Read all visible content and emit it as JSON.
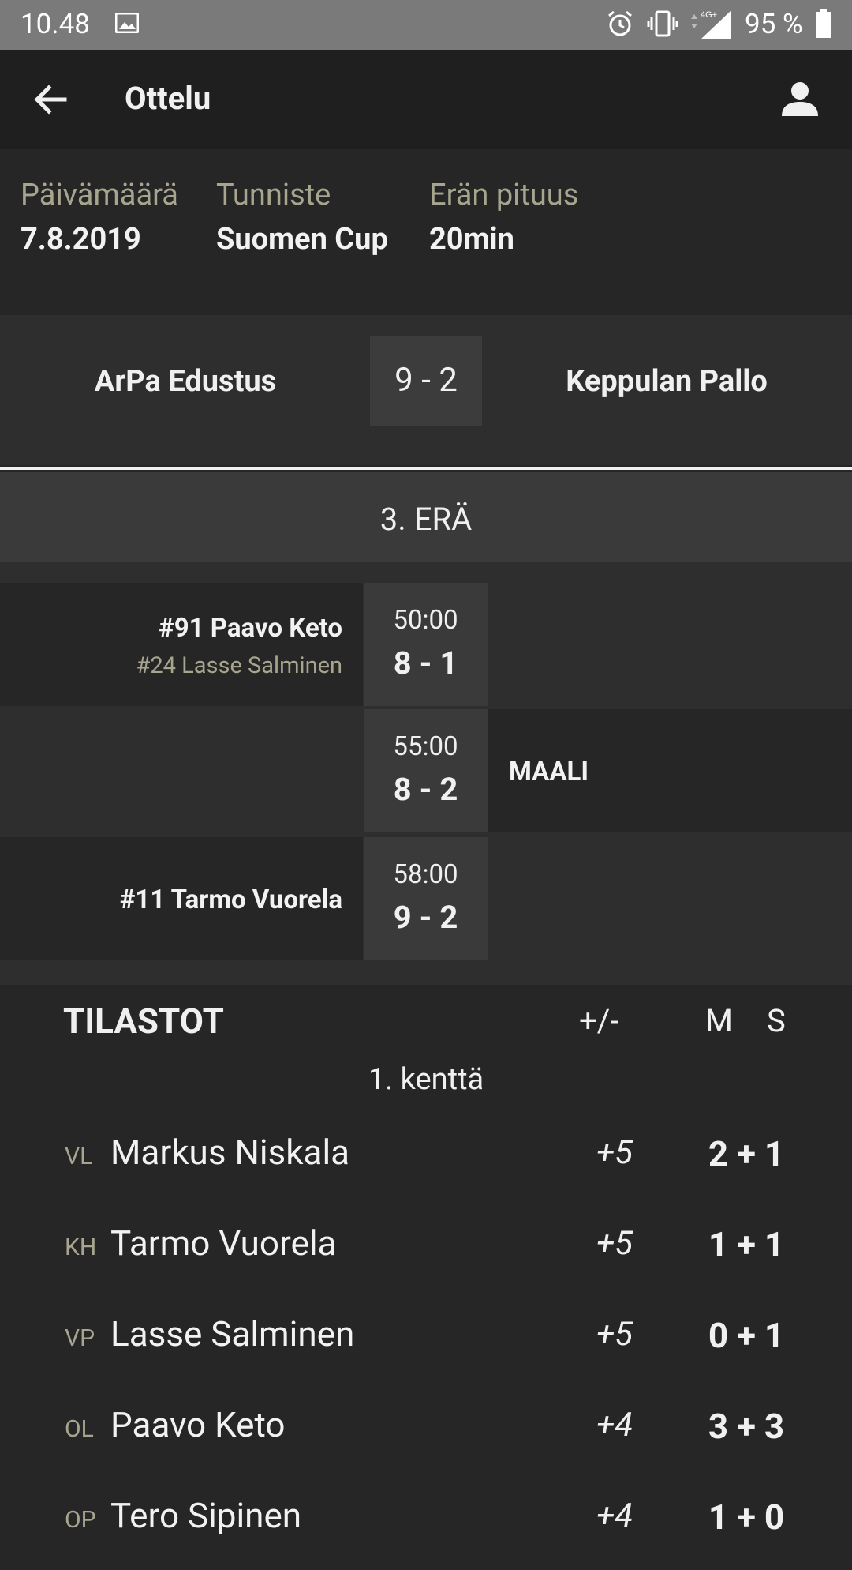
{
  "status_bar": {
    "time": "10.48",
    "battery_text": "95 %",
    "network_label": "4G+",
    "icons": [
      "image-icon",
      "alarm-icon",
      "vibrate-icon",
      "signal-icon",
      "battery-icon"
    ]
  },
  "app_bar": {
    "title": "Ottelu"
  },
  "info": {
    "date_label": "Päivämäärä",
    "date_value": "7.8.2019",
    "tag_label": "Tunniste",
    "tag_value": "Suomen Cup",
    "period_label": "Erän pituus",
    "period_value": "20min"
  },
  "match": {
    "home": "ArPa Edustus",
    "score": "9 - 2",
    "away": "Keppulan Pallo"
  },
  "period_header": "3. ERÄ",
  "events": [
    {
      "side": "home",
      "scorer": "#91 Paavo Keto",
      "assist": "#24 Lasse Salminen",
      "time": "50:00",
      "score": "8 - 1"
    },
    {
      "side": "away",
      "label": "MAALI",
      "time": "55:00",
      "score": "8 - 2"
    },
    {
      "side": "home",
      "scorer": "#11 Tarmo Vuorela",
      "time": "58:00",
      "score": "9 - 2"
    }
  ],
  "stats": {
    "title": "TILASTOT",
    "col_plusminus": "+/-",
    "col_m": "M",
    "col_s": "S",
    "line_label": "1. kenttä",
    "players": [
      {
        "pos": "VL",
        "name": "Markus Niskala",
        "pm": "+5",
        "pts": "2 + 1"
      },
      {
        "pos": "KH",
        "name": "Tarmo Vuorela",
        "pm": "+5",
        "pts": "1 + 1"
      },
      {
        "pos": "VP",
        "name": "Lasse Salminen",
        "pm": "+5",
        "pts": "0 + 1"
      },
      {
        "pos": "OL",
        "name": "Paavo Keto",
        "pm": "+4",
        "pts": "3 + 3"
      },
      {
        "pos": "OP",
        "name": "Tero Sipinen",
        "pm": "+4",
        "pts": "1 + 0"
      }
    ]
  }
}
